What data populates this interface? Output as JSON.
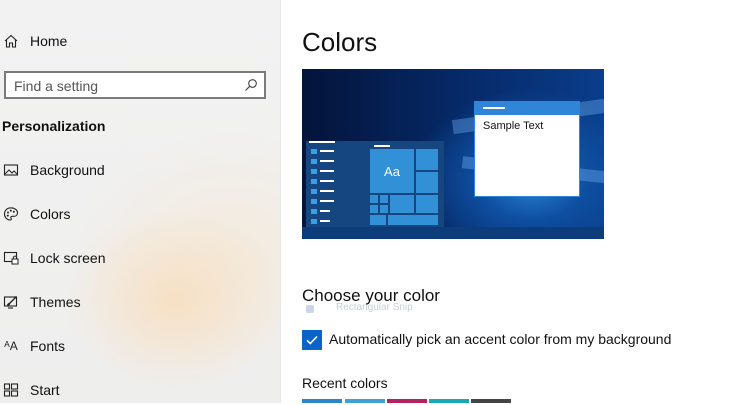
{
  "sidebar": {
    "home_label": "Home",
    "search": {
      "placeholder": "Find a setting"
    },
    "section_title": "Personalization",
    "items": [
      {
        "label": "Background",
        "icon": "picture-icon"
      },
      {
        "label": "Colors",
        "icon": "palette-icon"
      },
      {
        "label": "Lock screen",
        "icon": "lock-screen-icon"
      },
      {
        "label": "Themes",
        "icon": "themes-icon"
      },
      {
        "label": "Fonts",
        "icon": "fonts-icon"
      },
      {
        "label": "Start",
        "icon": "start-icon"
      }
    ],
    "fonts_glyph": "ᴬA"
  },
  "main": {
    "title": "Colors",
    "preview": {
      "tile_text": "Aa",
      "sample_text": "Sample Text"
    },
    "choose_heading": "Choose your color",
    "ghost_text": "Rectangular Snip",
    "auto_accent": {
      "label": "Automatically pick an accent color from my background",
      "checked": true
    },
    "recent_colors_label": "Recent colors",
    "recent_colors": [
      "#2d86c9",
      "#3ea1d9",
      "#b3245f",
      "#19a9b5",
      "#444444"
    ]
  },
  "colors": {
    "accent": "#0a64c8",
    "preview_accent": "#2f86d8"
  }
}
